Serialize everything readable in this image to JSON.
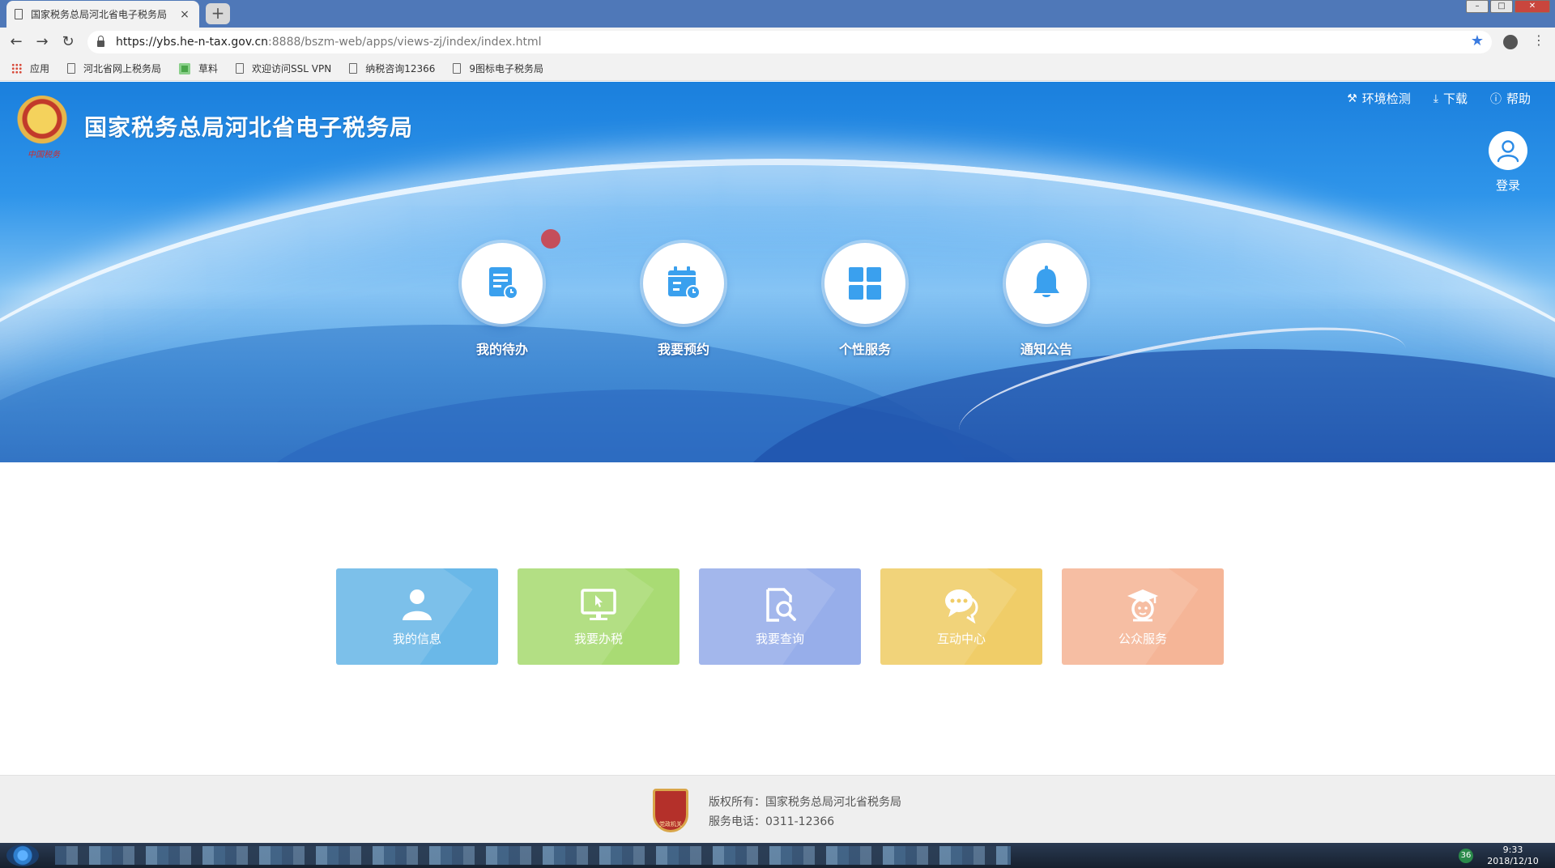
{
  "browser": {
    "tab_title": "国家税务总局河北省电子税务局",
    "tab_close": "×",
    "new_tab": "+",
    "url_main": "https://ybs.he-n-tax.gov.cn",
    "url_rest": ":8888/bszm-web/apps/views-zj/index/index.html",
    "back": "←",
    "forward": "→",
    "reload": "↻",
    "star": "★",
    "menu": "⋮",
    "win_min": "–",
    "win_max": "□",
    "win_close": "✕",
    "bookmarks": [
      "应用",
      "河北省网上税务局",
      "草料",
      "欢迎访问SSL VPN",
      "纳税咨询12366",
      "9图标电子税务局"
    ]
  },
  "header": {
    "site_title": "国家税务总局河北省电子税务局",
    "emblem_text": "中国税务",
    "util_links": [
      "环境检测",
      "下载",
      "帮助"
    ],
    "login_label": "登录"
  },
  "quick_actions": [
    {
      "label": "我的待办",
      "icon": "document-clock-icon"
    },
    {
      "label": "我要预约",
      "icon": "calendar-clock-icon"
    },
    {
      "label": "个性服务",
      "icon": "grid-icon"
    },
    {
      "label": "通知公告",
      "icon": "bell-icon"
    }
  ],
  "tiles": [
    {
      "label": "我的信息",
      "color": "#6ab8e8",
      "icon": "user-icon"
    },
    {
      "label": "我要办税",
      "color": "#a9db74",
      "icon": "monitor-cursor-icon"
    },
    {
      "label": "我要查询",
      "color": "#97aeea",
      "icon": "document-search-icon"
    },
    {
      "label": "互动中心",
      "color": "#f0cd68",
      "icon": "chat-bubble-icon"
    },
    {
      "label": "公众服务",
      "color": "#f5b597",
      "icon": "graduate-icon"
    }
  ],
  "footer": {
    "copyright": "版权所有：国家税务总局河北省税务局",
    "phone": "服务电话：0311-12366",
    "logo_text": "党政机关"
  },
  "taskbar": {
    "tray_badge": "36",
    "time": "9:33",
    "date": "2018/12/10"
  },
  "colors": {
    "banner_blue": "#1a7fdd",
    "icon_blue": "#3aa0ee",
    "footer_bg": "#efefef"
  }
}
